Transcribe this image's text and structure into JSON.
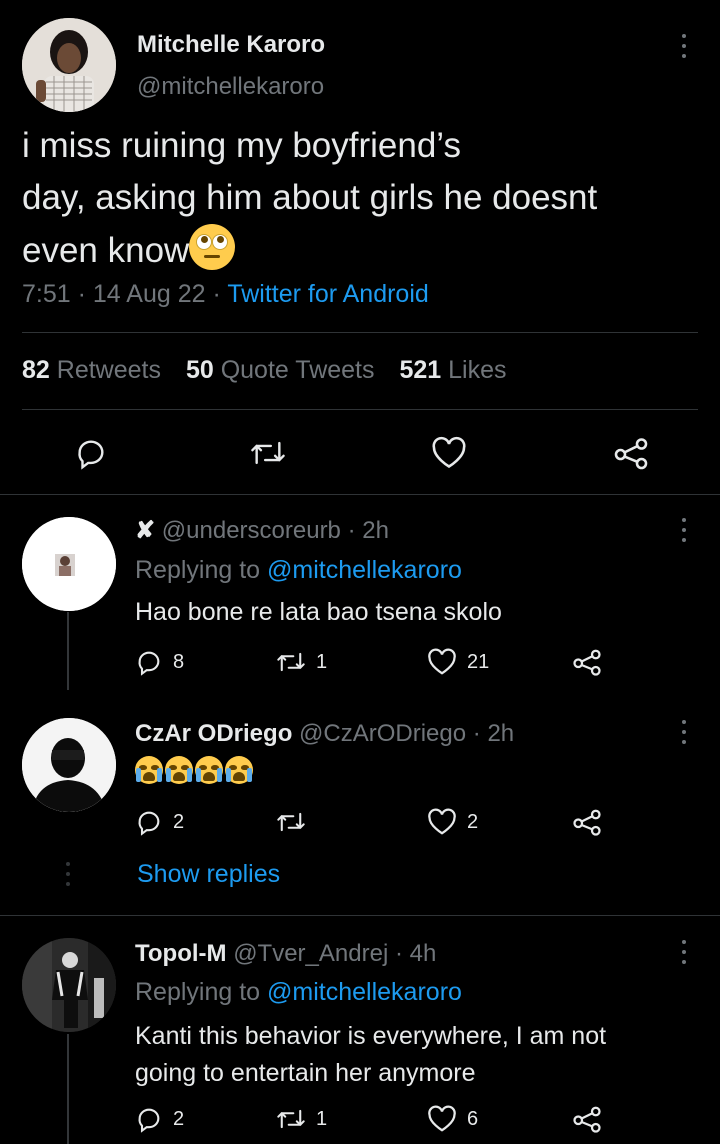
{
  "tweet": {
    "author_name": "Mitchelle Karoro",
    "author_handle": "@mitchellekaroro",
    "text_line1": "i miss ruining my boyfriend’s",
    "text_line2": "day, asking him about girls he doesnt",
    "text_line3": "even know",
    "text_emoji": "face-with-rolling-eyes",
    "time": "7:51",
    "dot": "·",
    "date": "14 Aug 22",
    "source": "Twitter for Android",
    "retweets_count": "82",
    "retweets_label": "Retweets",
    "quotes_count": "50",
    "quotes_label": "Quote Tweets",
    "likes_count": "521",
    "likes_label": "Likes"
  },
  "replies": [
    {
      "prefix_icon": "x-mark",
      "handle": "@underscoreurb",
      "time": "2h",
      "replying_label": "Replying to",
      "replying_to": "@mitchellekaroro",
      "text": "Hao bone re lata bao tsena skolo",
      "reply_count": "8",
      "retweet_count": "1",
      "like_count": "21"
    },
    {
      "name": "CzAr ODriego",
      "handle": "@CzArODriego",
      "time": "2h",
      "emojis": [
        "loudly-crying-face",
        "loudly-crying-face",
        "loudly-crying-face",
        "loudly-crying-face"
      ],
      "reply_count": "2",
      "retweet_count": "",
      "like_count": "2",
      "show_replies": "Show replies"
    },
    {
      "name": "Topol-M",
      "handle": "@Tver_Andrej",
      "time": "4h",
      "replying_label": "Replying to",
      "replying_to": "@mitchellekaroro",
      "text_line1": "Kanti this behavior is everywhere, I am not",
      "text_line2": "going to entertain her anymore",
      "reply_count": "2",
      "retweet_count": "1",
      "like_count": "6"
    }
  ],
  "colors": {
    "background": "#000000",
    "text": "#e7e9ea",
    "muted": "#71767b",
    "link": "#1d9bf0",
    "divider": "#2f3336"
  }
}
